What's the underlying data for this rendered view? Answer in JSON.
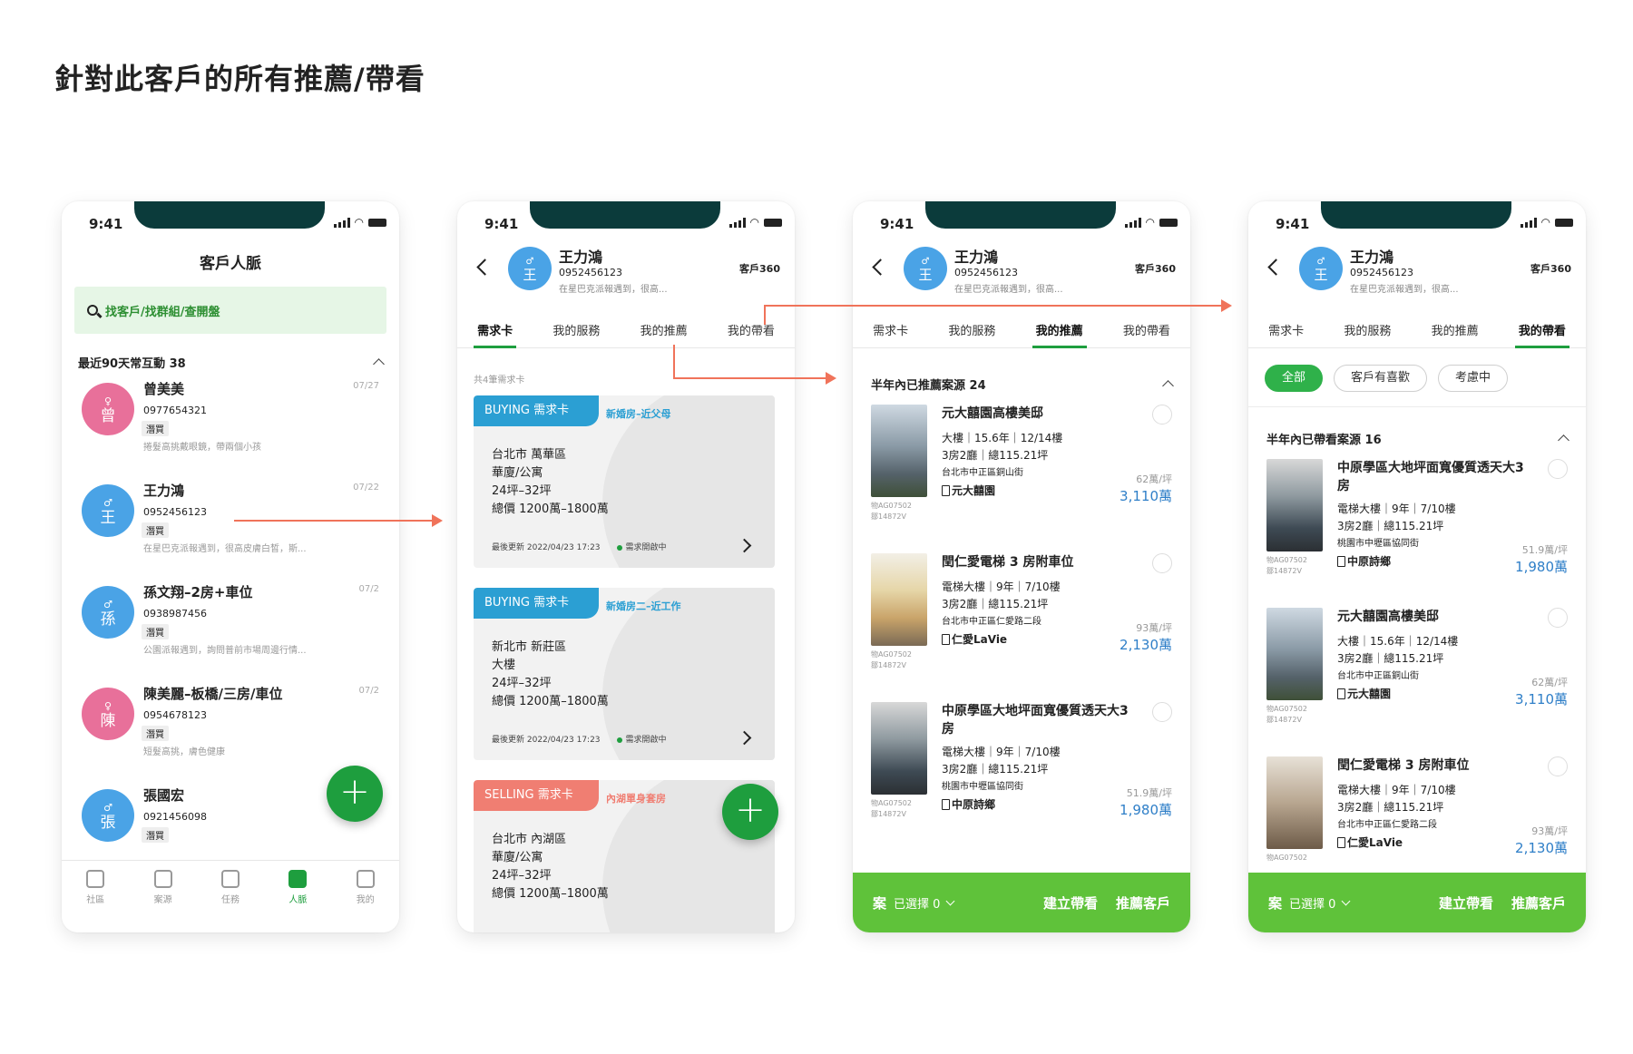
{
  "page_title": "針對此客戶的所有推薦/帶看",
  "status_time": "9:41",
  "accent": "#1e9e3e",
  "screen1": {
    "title": "客戶人脈",
    "search_placeholder": "找客戶/找群組/查開盤",
    "section_label": "最近90天常互動 38",
    "contacts": [
      {
        "initial": "曾",
        "gender": "♀",
        "name": "曾美美",
        "phone": "0977654321",
        "tag": "潛買",
        "note": "捲髮高挑戴眼鏡，帶兩個小孩",
        "date": "07/27",
        "color": "#e8709a"
      },
      {
        "initial": "王",
        "gender": "♂",
        "name": "王力鴻",
        "phone": "0952456123",
        "tag": "潛買",
        "note": "在星巴克派報遇到，很高皮膚白皙，斯...",
        "date": "07/22",
        "color": "#4aa3e6"
      },
      {
        "initial": "孫",
        "gender": "♂",
        "name": "孫文翔–2房+車位",
        "phone": "0938987456",
        "tag": "潛買",
        "note": "公園派報遇到，詢問普前市場周邊行情...",
        "date": "07/2",
        "color": "#4aa3e6"
      },
      {
        "initial": "陳",
        "gender": "♀",
        "name": "陳美麗–板橋/三房/車位",
        "phone": "0954678123",
        "tag": "潛買",
        "note": "短髮高挑，膚色健康",
        "date": "07/2",
        "color": "#e8709a"
      },
      {
        "initial": "張",
        "gender": "♂",
        "name": "張國宏",
        "phone": "0921456098",
        "tag": "潛買",
        "note": "",
        "date": "",
        "color": "#4aa3e6"
      }
    ],
    "tabbar": [
      "社區",
      "案源",
      "任務",
      "人脈",
      "我的"
    ]
  },
  "client": {
    "initial": "王",
    "gender": "♂",
    "name": "王力鴻",
    "phone": "0952456123",
    "note": "在星巴克派報遇到，很高...",
    "link": "客戶360",
    "tabs": [
      "需求卡",
      "我的服務",
      "我的推薦",
      "我的帶看"
    ]
  },
  "screen2": {
    "count_label": "共4筆需求卡",
    "cards": [
      {
        "badge": "BUYING 需求卡",
        "badge_color": "#2b9fd3",
        "sub": "新婚房–近父母",
        "sub_color": "#2b9fd3",
        "lines": [
          "台北市 萬華區",
          "華廈/公寓",
          "24坪–32坪",
          "總價 1200萬–1800萬"
        ],
        "updated": "最後更新 2022/04/23 17:23",
        "status": "需求開啟中"
      },
      {
        "badge": "BUYING 需求卡",
        "badge_color": "#2b9fd3",
        "sub": "新婚房二–近工作",
        "sub_color": "#2b9fd3",
        "lines": [
          "新北市 新莊區",
          "大樓",
          "24坪–32坪",
          "總價 1200萬–1800萬"
        ],
        "updated": "最後更新 2022/04/23 17:23",
        "status": "需求開啟中"
      },
      {
        "badge": "SELLING 需求卡",
        "badge_color": "#f07e72",
        "sub": "內湖單身套房",
        "sub_color": "#f07e72",
        "lines": [
          "台北市 內湖區",
          "華廈/公寓",
          "24坪–32坪",
          "總價 1200萬–1800萬"
        ],
        "updated": "",
        "status": ""
      }
    ]
  },
  "screen3": {
    "section_label": "半年內已推薦案源 24",
    "properties": [
      {
        "title": "元大囍園高樓美邸",
        "info": "大樓｜15.6年｜12/14樓",
        "rooms": "3房2廳｜總115.21坪",
        "addr": "台北市中正區銅山街",
        "community": "元大囍園",
        "unit": "62萬/坪",
        "price": "3,110萬",
        "id1": "物AG07502",
        "id2": "鄒14872V",
        "img": "t-bld"
      },
      {
        "title": "閏仁愛電梯 3 房附車位",
        "info": "電梯大樓｜9年｜7/10樓",
        "rooms": "3房2廳｜總115.21坪",
        "addr": "台北市中正區仁愛路二段",
        "community": "仁愛LaVie",
        "unit": "93萬/坪",
        "price": "2,130萬",
        "id1": "物AG07502",
        "id2": "鄒14872V",
        "img": "t-kit"
      },
      {
        "title": "中原學區大地坪面寬優質透天大3房",
        "info": "電梯大樓｜9年｜7/10樓",
        "rooms": "3房2廳｜總115.21坪",
        "addr": "桃園市中壢區協同街",
        "community": "中原詩鄉",
        "unit": "51.9萬/坪",
        "price": "1,980萬",
        "id1": "物AG07502",
        "id2": "鄒14872V",
        "img": "t-liv"
      }
    ],
    "bottom": {
      "icon_label": "案",
      "selected": "已選擇 0",
      "action1": "建立帶看",
      "action2": "推薦客戶"
    }
  },
  "screen4": {
    "chips": [
      "全部",
      "客戶有喜歡",
      "考慮中"
    ],
    "section_label": "半年內已帶看案源 16",
    "properties": [
      {
        "title": "中原學區大地坪面寬優質透天大3房",
        "info": "電梯大樓｜9年｜7/10樓",
        "rooms": "3房2廳｜總115.21坪",
        "addr": "桃園市中壢區協同街",
        "community": "中原詩鄉",
        "unit": "51.9萬/坪",
        "price": "1,980萬",
        "id1": "物AG07502",
        "id2": "鄒14872V",
        "img": "t-liv"
      },
      {
        "title": "元大囍園高樓美邸",
        "info": "大樓｜15.6年｜12/14樓",
        "rooms": "3房2廳｜總115.21坪",
        "addr": "台北市中正區銅山街",
        "community": "元大囍園",
        "unit": "62萬/坪",
        "price": "3,110萬",
        "id1": "物AG07502",
        "id2": "鄒14872V",
        "img": "t-bld"
      },
      {
        "title": "閏仁愛電梯 3 房附車位",
        "info": "電梯大樓｜9年｜7/10樓",
        "rooms": "3房2廳｜總115.21坪",
        "addr": "台北市中正區仁愛路二段",
        "community": "仁愛LaVie",
        "unit": "93萬/坪",
        "price": "2,130萬",
        "id1": "物AG07502",
        "id2": "",
        "img": "t-room"
      }
    ],
    "bottom": {
      "icon_label": "案",
      "selected": "已選擇 0",
      "action1": "建立帶看",
      "action2": "推薦客戶"
    }
  }
}
